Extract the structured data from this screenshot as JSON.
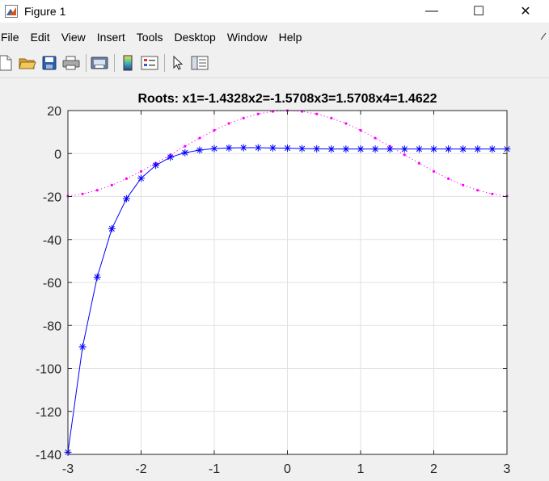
{
  "window": {
    "title": "Figure 1",
    "app_icon": "matlab-icon",
    "controls": {
      "minimize": "—",
      "maximize": "☐",
      "close": "✕"
    }
  },
  "menu": {
    "items": [
      "File",
      "Edit",
      "View",
      "Insert",
      "Tools",
      "Desktop",
      "Window",
      "Help"
    ]
  },
  "toolbar": {
    "icons": [
      "new-figure-icon",
      "open-file-icon",
      "save-icon",
      "print-icon",
      "print-preview-icon",
      "colorbar-icon",
      "legend-icon",
      "pointer-icon",
      "property-editor-icon"
    ]
  },
  "chart_data": {
    "type": "line",
    "title": "Roots: x1=-1.4328x2=-1.5708x3=1.5708x4=1.4622",
    "xlabel": "",
    "ylabel": "",
    "xlim": [
      -3,
      3
    ],
    "ylim": [
      -140,
      20
    ],
    "xticks": [
      "-3",
      "-2",
      "-1",
      "0",
      "1",
      "2",
      "3"
    ],
    "yticks": [
      "20",
      "0",
      "-20",
      "-40",
      "-60",
      "-80",
      "-100",
      "-120",
      "-140"
    ],
    "grid": true,
    "colors": {
      "series1": "#0000ff",
      "series2": "#ff00ff"
    },
    "series": [
      {
        "style": "solid line with asterisk markers",
        "x": [
          -3,
          -2.8,
          -2.6,
          -2.4,
          -2.2,
          -2,
          -1.8,
          -1.6,
          -1.4,
          -1.2,
          -1,
          -0.8,
          -0.6,
          -0.4,
          -0.2,
          0,
          0.2,
          0.4,
          0.6,
          0.8,
          1,
          1.2,
          1.4,
          1.6,
          1.8,
          2,
          2.2,
          2.4,
          2.6,
          2.8,
          3
        ],
        "values": [
          -139,
          -90,
          -57.5,
          -35,
          -21,
          -11.5,
          -5.5,
          -1.7,
          0.4,
          1.6,
          2.3,
          2.6,
          2.7,
          2.7,
          2.6,
          2.5,
          2.3,
          2.2,
          2.1,
          2.1,
          2.1,
          2.1,
          2.1,
          2.1,
          2.1,
          2.1,
          2.1,
          2.1,
          2.1,
          2.1,
          2.1
        ]
      },
      {
        "style": "dotted line with point markers",
        "x": [
          -3,
          -2.8,
          -2.6,
          -2.4,
          -2.2,
          -2,
          -1.8,
          -1.6,
          -1.4,
          -1.2,
          -1,
          -0.8,
          -0.6,
          -0.4,
          -0.2,
          0,
          0.2,
          0.4,
          0.6,
          0.8,
          1,
          1.2,
          1.4,
          1.6,
          1.8,
          2,
          2.2,
          2.4,
          2.6,
          2.8,
          3
        ],
        "values": [
          -19.8,
          -18.8,
          -17.1,
          -14.7,
          -11.7,
          -8.3,
          -4.5,
          -0.6,
          3.4,
          7.2,
          10.8,
          14,
          16.5,
          18.4,
          19.6,
          20,
          19.6,
          18.4,
          16.5,
          14,
          10.8,
          7.2,
          3.4,
          -0.6,
          -4.5,
          -8.3,
          -11.7,
          -14.7,
          -17.1,
          -18.8,
          -19.8
        ]
      }
    ]
  }
}
